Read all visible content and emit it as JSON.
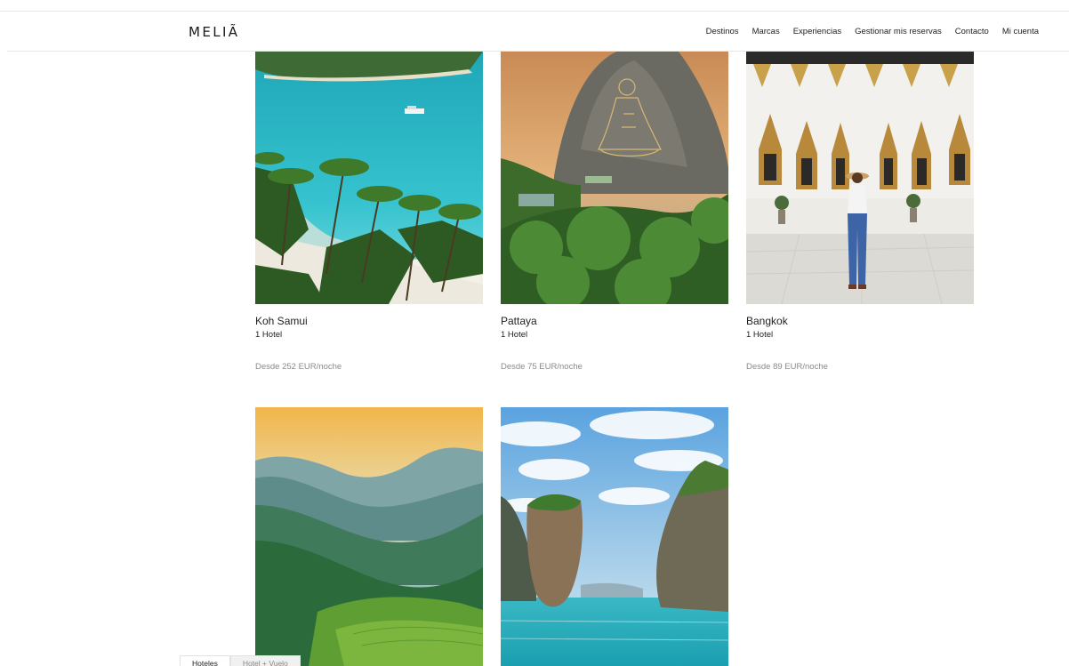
{
  "header": {
    "logo": "MELIÃ",
    "nav": [
      "Destinos",
      "Marcas",
      "Experiencias",
      "Gestionar mis reservas",
      "Contacto",
      "Mi cuenta"
    ]
  },
  "destinations": [
    {
      "name": "Koh Samui",
      "hotels": "1 Hotel",
      "price": "Desde 252 EUR/noche"
    },
    {
      "name": "Pattaya",
      "hotels": "1 Hotel",
      "price": "Desde 75 EUR/noche"
    },
    {
      "name": "Bangkok",
      "hotels": "1 Hotel",
      "price": "Desde 89 EUR/noche"
    },
    {
      "name": "",
      "hotels": "",
      "price": ""
    },
    {
      "name": "",
      "hotels": "",
      "price": ""
    }
  ],
  "search_tabs": [
    "Hoteles",
    "Hotel + Vuelo"
  ]
}
